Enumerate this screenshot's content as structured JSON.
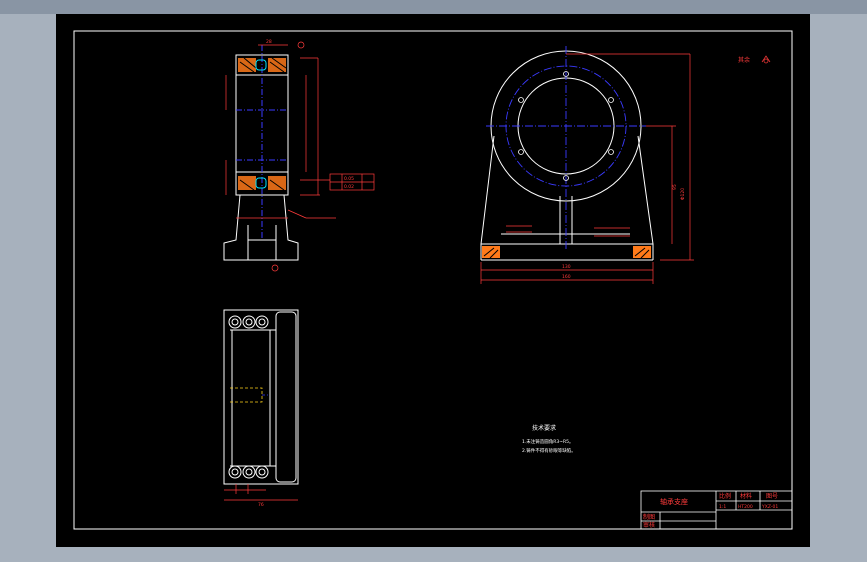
{
  "drawing": {
    "tech_req_title": "技术要求",
    "tech_req_lines": [
      "1.未注铸造圆角R3~R5。",
      "2.铸件不得有砂眼等缺陷。"
    ],
    "roughness_label": "其余",
    "title_block": {
      "part_name": "轴承支座",
      "header_cells": [
        "比例",
        "材料",
        "图号"
      ],
      "value_cells": [
        "1:1",
        "HT200",
        "YXZ-01"
      ],
      "row_labels": [
        "制图",
        "审核"
      ]
    },
    "dims": {
      "front_total_width": "160",
      "front_inner_width": "130",
      "front_height": "95",
      "front_total_height": "Φ120",
      "side_top_width": "28",
      "side_width": "76",
      "plan_width": "76",
      "tol_a": "0.05",
      "tol_b": "0.02"
    },
    "colors": {
      "line": "#ffffff",
      "dim": "#ff3b3b",
      "center": "#3a3aff",
      "hatch": "#ff7a1a",
      "cyan": "#00e5ff"
    }
  }
}
